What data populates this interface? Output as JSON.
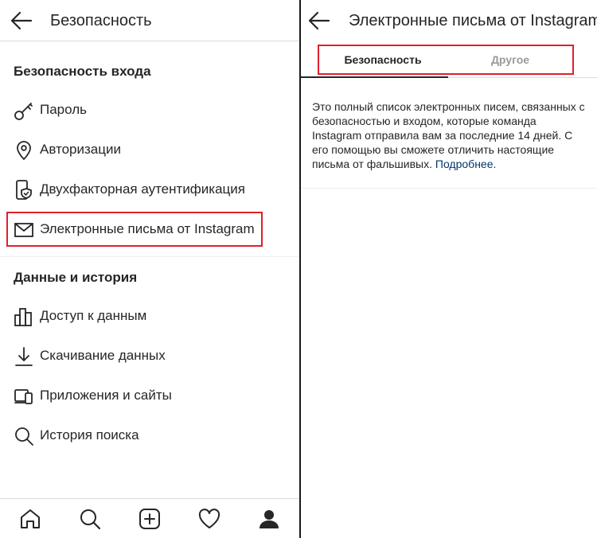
{
  "left": {
    "header": {
      "title": "Безопасность"
    },
    "sections": [
      {
        "title": "Безопасность входа",
        "items": [
          {
            "label": "Пароль",
            "icon": "key-icon"
          },
          {
            "label": "Авторизации",
            "icon": "location-pin-icon"
          },
          {
            "label": "Двухфакторная аутентификация",
            "icon": "phone-shield-icon"
          },
          {
            "label": "Электронные письма от Instagram",
            "icon": "mail-icon"
          }
        ]
      },
      {
        "title": "Данные и история",
        "items": [
          {
            "label": "Доступ к данным",
            "icon": "bar-chart-icon"
          },
          {
            "label": "Скачивание данных",
            "icon": "download-icon"
          },
          {
            "label": "Приложения и сайты",
            "icon": "devices-icon"
          },
          {
            "label": "История поиска",
            "icon": "search-icon"
          }
        ]
      }
    ],
    "bottom_nav": [
      "home-icon",
      "search-icon",
      "new-post-icon",
      "heart-icon",
      "profile-icon"
    ]
  },
  "right": {
    "header": {
      "title": "Электронные письма от Instagram"
    },
    "tabs": [
      {
        "label": "Безопасность",
        "active": true
      },
      {
        "label": "Другое",
        "active": false
      }
    ],
    "description": "Это полный список электронных писем, связанных с безопасностью и входом, которые команда Instagram отправила вам за последние 14 дней. С его помощью вы сможете отличить настоящие письма от фальшивых.",
    "learn_more": "Подробнее."
  },
  "colors": {
    "text": "#262626",
    "highlight": "#e0202a",
    "link": "#00376b",
    "inactive_tab": "#9a9a9a"
  }
}
